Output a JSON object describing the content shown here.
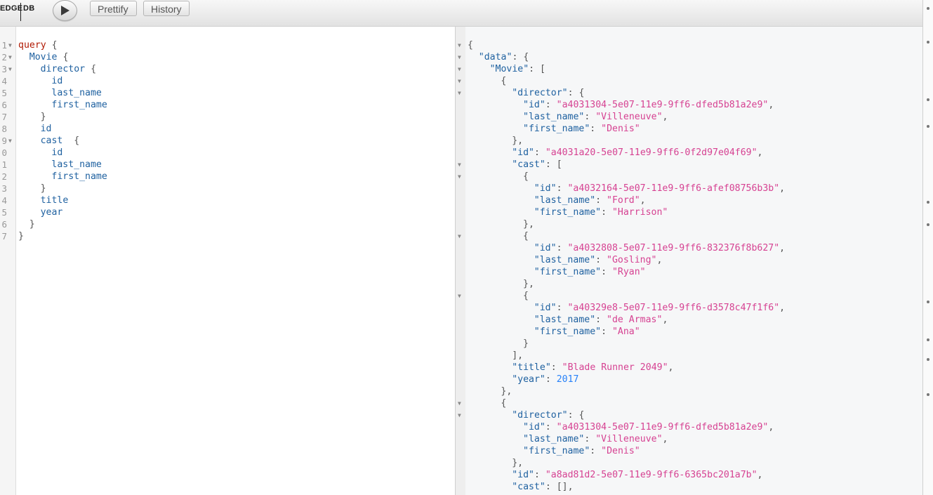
{
  "toolbar": {
    "logo_left": "EDGE",
    "logo_right": "DB",
    "run_icon": "play-icon",
    "prettify_label": "Prettify",
    "history_label": "History"
  },
  "colors": {
    "keyword": "#b11a04",
    "field": "#1f61a0",
    "string": "#d64292",
    "number": "#2882f9",
    "punctuation": "#555555"
  },
  "editor": {
    "line_numbers": [
      "1",
      "2",
      "3",
      "4",
      "5",
      "6",
      "7",
      "8",
      "9",
      "0",
      "1",
      "2",
      "3",
      "4",
      "5",
      "6",
      "7"
    ],
    "lines": [
      {
        "k": "query",
        " p": " {"
      },
      {
        "f": "Movie",
        "p": " {"
      },
      {
        "f": "director",
        "p": " {"
      },
      {
        "f": "id"
      },
      {
        "f": "last_name"
      },
      {
        "f": "first_name"
      },
      {
        "p": "}"
      },
      {
        "f": "id"
      },
      {
        "f": "cast",
        "p": "  {"
      },
      {
        "f": "id"
      },
      {
        "f": "last_name"
      },
      {
        "f": "first_name"
      },
      {
        "p": "}"
      },
      {
        "f": "title"
      },
      {
        "f": "year"
      },
      {
        "p": "}"
      },
      {
        "p": "}"
      }
    ]
  },
  "result": {
    "lines": [
      {
        "p": "{"
      },
      {
        "key": "\"data\"",
        "p": ": {"
      },
      {
        "key": "\"Movie\"",
        "p": ": ["
      },
      {
        "p": "{"
      },
      {
        "key": "\"director\"",
        "p": ": {"
      },
      {
        "key": "\"id\"",
        "p": ": ",
        "str": "\"a4031304-5e07-11e9-9ff6-dfed5b81a2e9\"",
        "e": ","
      },
      {
        "key": "\"last_name\"",
        "p": ": ",
        "str": "\"Villeneuve\"",
        "e": ","
      },
      {
        "key": "\"first_name\"",
        "p": ": ",
        "str": "\"Denis\""
      },
      {
        "p": "},"
      },
      {
        "key": "\"id\"",
        "p": ": ",
        "str": "\"a4031a20-5e07-11e9-9ff6-0f2d97e04f69\"",
        "e": ","
      },
      {
        "key": "\"cast\"",
        "p": ": ["
      },
      {
        "p": "{"
      },
      {
        "key": "\"id\"",
        "p": ": ",
        "str": "\"a4032164-5e07-11e9-9ff6-afef08756b3b\"",
        "e": ","
      },
      {
        "key": "\"last_name\"",
        "p": ": ",
        "str": "\"Ford\"",
        "e": ","
      },
      {
        "key": "\"first_name\"",
        "p": ": ",
        "str": "\"Harrison\""
      },
      {
        "p": "},"
      },
      {
        "p": "{"
      },
      {
        "key": "\"id\"",
        "p": ": ",
        "str": "\"a4032808-5e07-11e9-9ff6-832376f8b627\"",
        "e": ","
      },
      {
        "key": "\"last_name\"",
        "p": ": ",
        "str": "\"Gosling\"",
        "e": ","
      },
      {
        "key": "\"first_name\"",
        "p": ": ",
        "str": "\"Ryan\""
      },
      {
        "p": "},"
      },
      {
        "p": "{"
      },
      {
        "key": "\"id\"",
        "p": ": ",
        "str": "\"a40329e8-5e07-11e9-9ff6-d3578c47f1f6\"",
        "e": ","
      },
      {
        "key": "\"last_name\"",
        "p": ": ",
        "str": "\"de Armas\"",
        "e": ","
      },
      {
        "key": "\"first_name\"",
        "p": ": ",
        "str": "\"Ana\""
      },
      {
        "p": "}"
      },
      {
        "p": "],"
      },
      {
        "key": "\"title\"",
        "p": ": ",
        "str": "\"Blade Runner 2049\"",
        "e": ","
      },
      {
        "key": "\"year\"",
        "p": ": ",
        "num": "2017"
      },
      {
        "p": "},"
      },
      {
        "p": "{"
      },
      {
        "key": "\"director\"",
        "p": ": {"
      },
      {
        "key": "\"id\"",
        "p": ": ",
        "str": "\"a4031304-5e07-11e9-9ff6-dfed5b81a2e9\"",
        "e": ","
      },
      {
        "key": "\"last_name\"",
        "p": ": ",
        "str": "\"Villeneuve\"",
        "e": ","
      },
      {
        "key": "\"first_name\"",
        "p": ": ",
        "str": "\"Denis\""
      },
      {
        "p": "},"
      },
      {
        "key": "\"id\"",
        "p": ": ",
        "str": "\"a8ad81d2-5e07-11e9-9ff6-6365bc201a7b\"",
        "e": ","
      },
      {
        "key": "\"cast\"",
        "p": ": [],"
      }
    ]
  }
}
